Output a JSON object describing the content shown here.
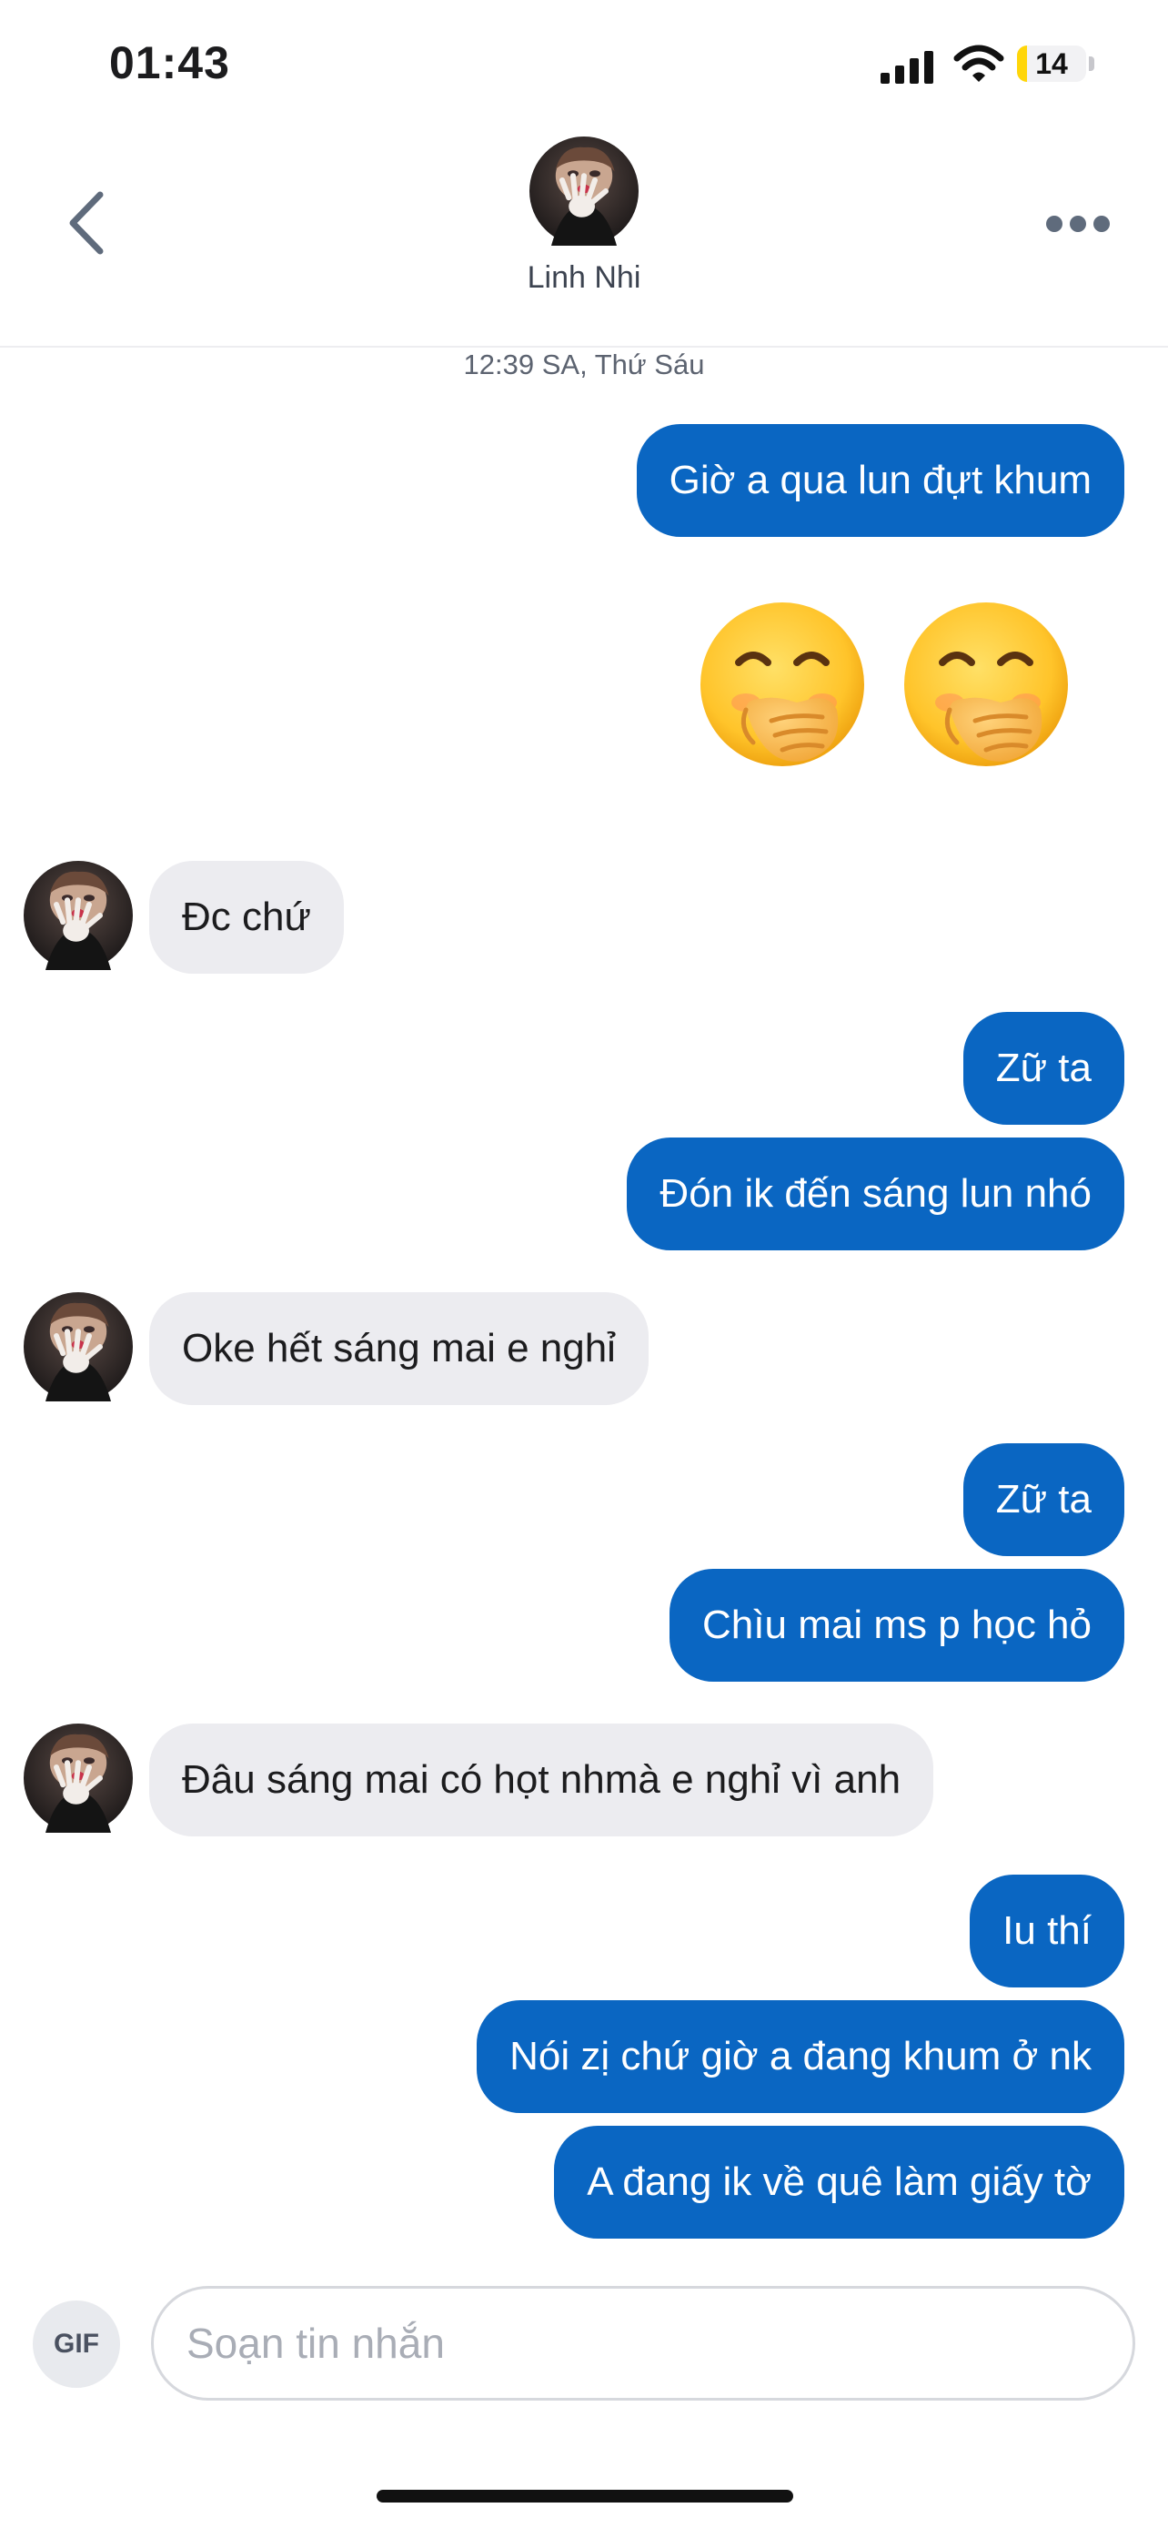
{
  "status_bar": {
    "time": "01:43",
    "battery_level": "14",
    "battery_fraction": 0.14,
    "icons": [
      "signal-icon",
      "wifi-icon",
      "battery-icon"
    ]
  },
  "header": {
    "contact_name": "Linh Nhi",
    "icons": [
      "back-chevron-icon",
      "more-dots-icon"
    ]
  },
  "conversation": {
    "date_label": "12:39 SA, Thứ Sáu",
    "messages": [
      {
        "dir": "sent",
        "text": "Giờ a qua lun đựt khum"
      },
      {
        "dir": "sent",
        "text": "🤭🤭",
        "emoji_name": "face-with-hand-over-mouth"
      },
      {
        "dir": "received",
        "text": "Đc chứ"
      },
      {
        "dir": "sent",
        "text": "Zữ ta"
      },
      {
        "dir": "sent",
        "text": "Đón ik đến sáng lun nhó"
      },
      {
        "dir": "received",
        "text": "Oke hết sáng mai e nghỉ"
      },
      {
        "dir": "sent",
        "text": "Zữ ta"
      },
      {
        "dir": "sent",
        "text": "Chìu mai ms p học hỏ"
      },
      {
        "dir": "received",
        "text": "Đâu sáng mai có họt nhmà e nghỉ vì anh"
      },
      {
        "dir": "sent",
        "text": "Iu thí"
      },
      {
        "dir": "sent",
        "text": "Nói zị chứ giờ a đang khum ở nk"
      },
      {
        "dir": "sent",
        "text": "A đang ik về quê làm giấy tờ"
      }
    ]
  },
  "composer": {
    "gif_label": "GIF",
    "input_value": "",
    "placeholder": "Soạn tin nhắn"
  },
  "colors": {
    "sent_bubble": "#0a66c2",
    "received_bubble": "#ececf0",
    "battery": "#ffd60a"
  }
}
